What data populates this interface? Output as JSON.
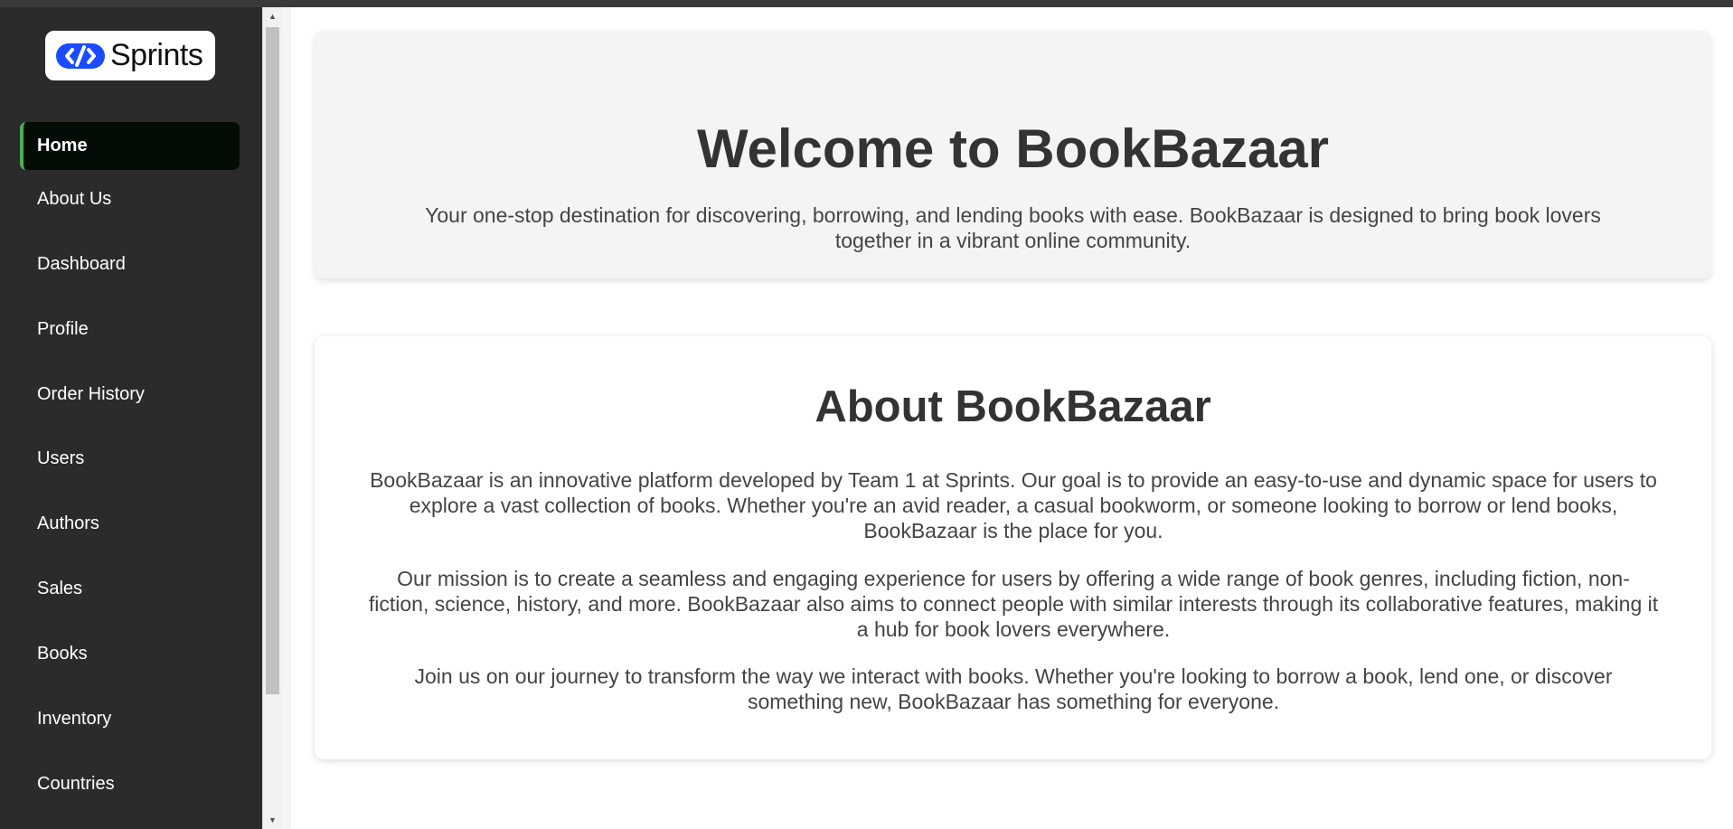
{
  "colors": {
    "sidebar_bg": "#2b2b2b",
    "active_bg": "#030d05",
    "active_accent": "#4caf50",
    "logo_blue": "#1a4cff",
    "hero_bg": "#f4f4f4",
    "text_dark": "#333333"
  },
  "logo": {
    "icon": "sprints-logo-icon",
    "text": "Sprints"
  },
  "sidebar": {
    "items": [
      {
        "label": "Home",
        "active": true
      },
      {
        "label": "About Us",
        "active": false
      },
      {
        "label": "Dashboard",
        "active": false
      },
      {
        "label": "Profile",
        "active": false
      },
      {
        "label": "Order History",
        "active": false
      },
      {
        "label": "Users",
        "active": false
      },
      {
        "label": "Authors",
        "active": false
      },
      {
        "label": "Sales",
        "active": false
      },
      {
        "label": "Books",
        "active": false
      },
      {
        "label": "Inventory",
        "active": false
      },
      {
        "label": "Countries",
        "active": false
      }
    ]
  },
  "hero": {
    "title": "Welcome to BookBazaar",
    "subtitle": "Your one-stop destination for discovering, borrowing, and lending books with ease. BookBazaar is designed to bring book lovers together in a vibrant online community."
  },
  "about": {
    "title": "About BookBazaar",
    "paragraphs": [
      "BookBazaar is an innovative platform developed by Team 1 at Sprints. Our goal is to provide an easy-to-use and dynamic space for users to explore a vast collection of books. Whether you're an avid reader, a casual bookworm, or someone looking to borrow or lend books, BookBazaar is the place for you.",
      "Our mission is to create a seamless and engaging experience for users by offering a wide range of book genres, including fiction, non-fiction, science, history, and more. BookBazaar also aims to connect people with similar interests through its collaborative features, making it a hub for book lovers everywhere.",
      "Join us on our journey to transform the way we interact with books. Whether you're looking to borrow a book, lend one, or discover something new, BookBazaar has something for everyone."
    ]
  }
}
